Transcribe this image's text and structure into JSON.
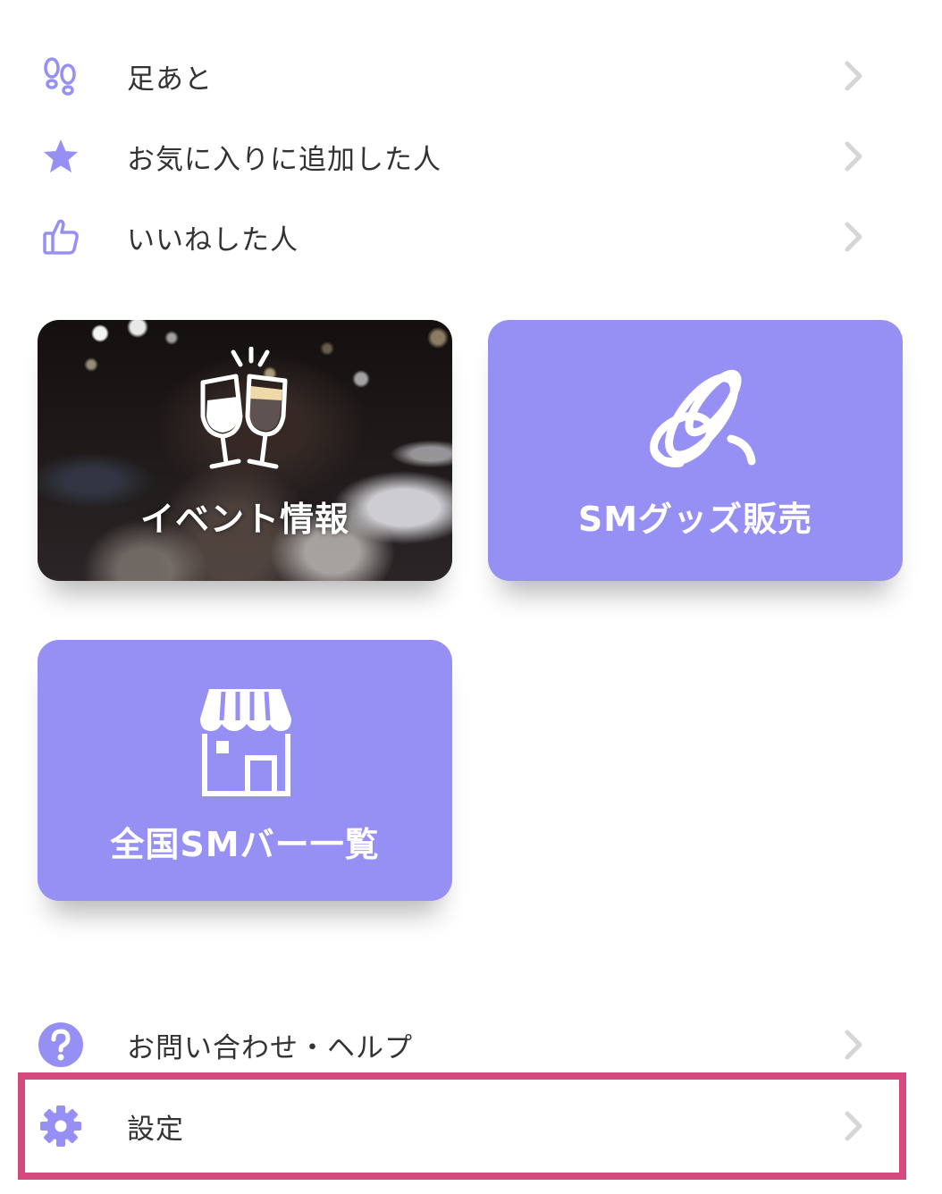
{
  "menu_top": [
    {
      "label": "足あと",
      "icon": "footprints-icon"
    },
    {
      "label": "お気に入りに追加した人",
      "icon": "star-icon"
    },
    {
      "label": "いいねした人",
      "icon": "thumbs-up-icon"
    }
  ],
  "tiles": [
    {
      "label": "イベント情報",
      "icon": "toast-glasses-icon",
      "style": "photo"
    },
    {
      "label": "SMグッズ販売",
      "icon": "rope-icon",
      "style": "purple"
    },
    {
      "label": "全国SMバー一覧",
      "icon": "shop-icon",
      "style": "purple"
    }
  ],
  "menu_bottom": [
    {
      "label": "お問い合わせ・ヘルプ",
      "icon": "help-icon"
    },
    {
      "label": "設定",
      "icon": "gear-icon"
    }
  ],
  "colors": {
    "accent": "#9690f5",
    "chevron": "#d6d6d6",
    "highlight": "#d44a7c",
    "text": "#333333"
  }
}
